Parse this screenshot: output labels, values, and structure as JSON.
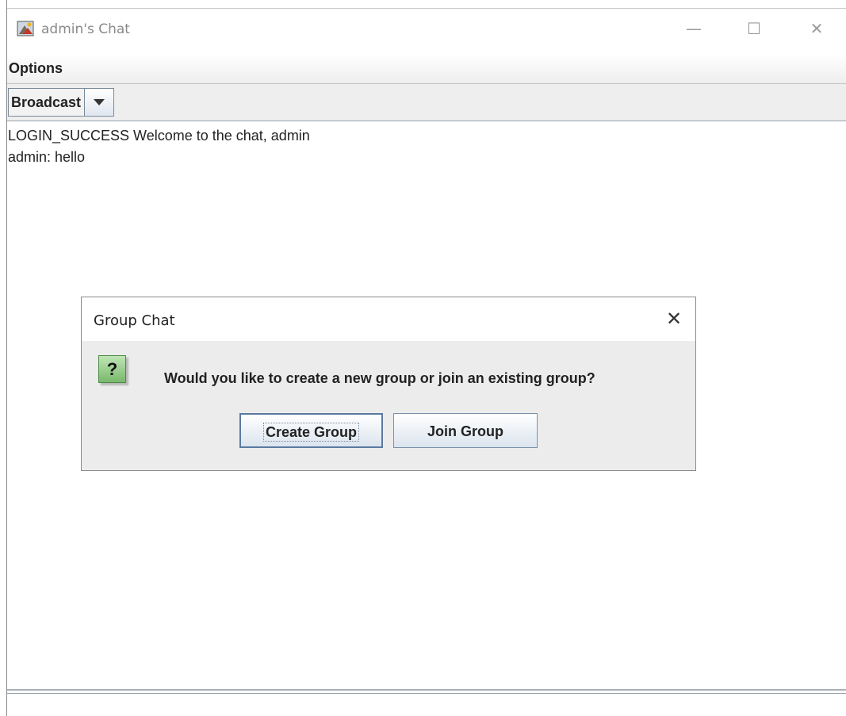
{
  "window": {
    "title": "admin's Chat",
    "controls": {
      "minimize": "—",
      "maximize": "☐",
      "close": "✕"
    }
  },
  "menu": {
    "options_label": "Options"
  },
  "toolbar": {
    "recipient_selected": "Broadcast"
  },
  "messages": [
    "LOGIN_SUCCESS Welcome to the chat, admin",
    "admin: hello"
  ],
  "dialog": {
    "title": "Group Chat",
    "close": "✕",
    "icon": "?",
    "message": "Would you like to create a new group or join an existing group?",
    "create_label": "Create Group",
    "join_label": "Join Group"
  },
  "colors": {
    "question_icon": "#79b86b",
    "button_border": "#7a90a8"
  }
}
